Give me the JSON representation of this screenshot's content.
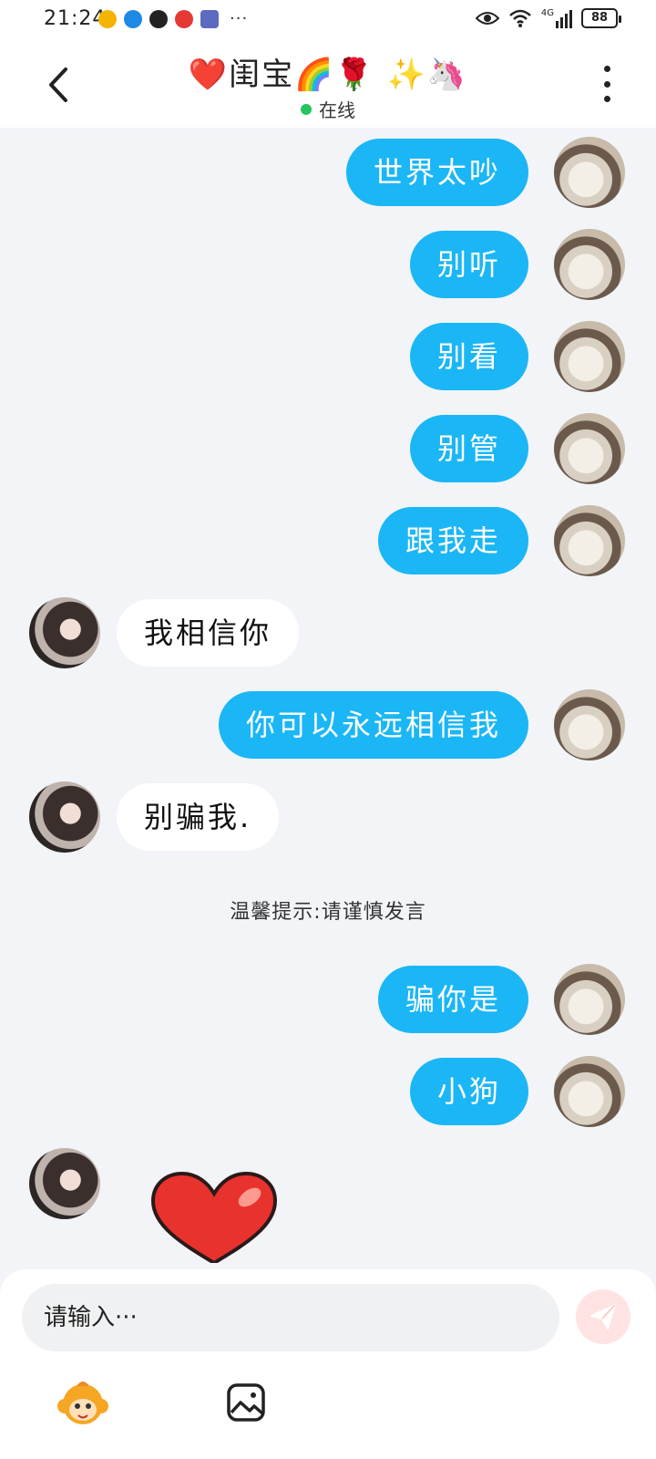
{
  "status_bar": {
    "time": "21:24",
    "more": "···",
    "network": "4G",
    "battery": "88"
  },
  "header": {
    "title": "❤️闺宝🌈🌹 ✨🦄",
    "status": "在线"
  },
  "messages": [
    {
      "from": "me",
      "text": "世界太吵"
    },
    {
      "from": "me",
      "text": "别听"
    },
    {
      "from": "me",
      "text": "别看"
    },
    {
      "from": "me",
      "text": "别管"
    },
    {
      "from": "me",
      "text": "跟我走"
    },
    {
      "from": "her",
      "text": "我相信你"
    },
    {
      "from": "me",
      "text": "你可以永远相信我"
    },
    {
      "from": "her",
      "text": "别骗我."
    },
    {
      "type": "notice",
      "text": "温馨提示:请谨慎发言"
    },
    {
      "from": "me",
      "text": "骗你是"
    },
    {
      "from": "me",
      "text": "小狗"
    },
    {
      "from": "her",
      "sticker": "heart-sticker"
    }
  ],
  "input": {
    "placeholder": "请输入···"
  },
  "colors": {
    "my_bubble": "#1bb6f5",
    "her_bubble": "#ffffff",
    "background": "#f2f4f8",
    "online": "#22c55e",
    "send_button": "#ffe3e3"
  },
  "icons": [
    "back-arrow-icon",
    "more-vert-icon",
    "send-icon",
    "monkey-emoji-icon",
    "image-icon",
    "heart-sticker"
  ]
}
